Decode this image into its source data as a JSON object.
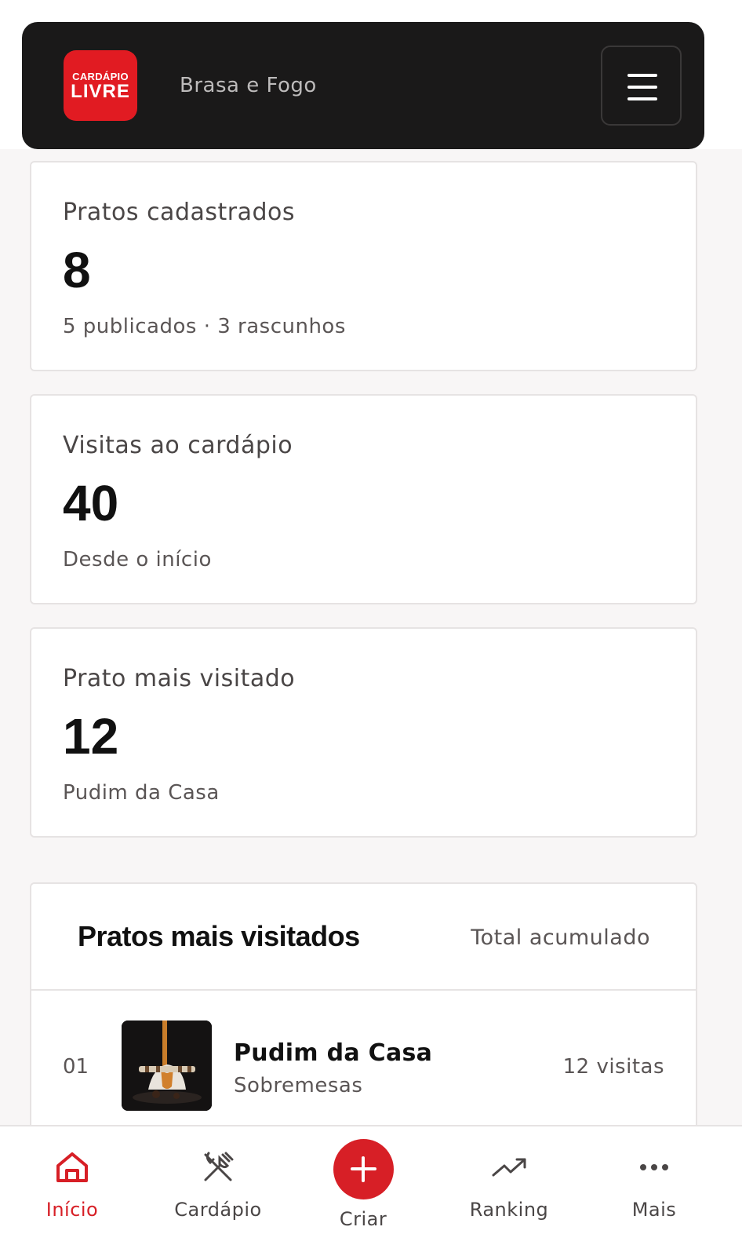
{
  "header": {
    "logo_line1": "CARDÁPIO",
    "logo_line2": "LIVRE",
    "restaurant_name": "Brasa e Fogo",
    "menu_icon": "hamburger-menu-icon"
  },
  "stats": [
    {
      "label": "Pratos cadastrados",
      "value": "8",
      "sub": "5 publicados · 3 rascunhos"
    },
    {
      "label": "Visitas ao cardápio",
      "value": "40",
      "sub": "Desde o início"
    },
    {
      "label": "Prato mais visitado",
      "value": "12",
      "sub": "Pudim da Casa"
    }
  ],
  "ranking": {
    "title": "Pratos mais visitados",
    "subtitle": "Total acumulado",
    "items": [
      {
        "rank": "01",
        "name": "Pudim da Casa",
        "category": "Sobremesas",
        "visits": "12 visitas",
        "image": "pudim-photo"
      }
    ]
  },
  "bottom_nav": {
    "items": [
      {
        "label": "Início",
        "icon": "home-icon",
        "active": true
      },
      {
        "label": "Cardápio",
        "icon": "utensils-crossed-icon",
        "active": false
      },
      {
        "label": "Criar",
        "icon": "plus-icon",
        "active": false
      },
      {
        "label": "Ranking",
        "icon": "trending-up-icon",
        "active": false
      },
      {
        "label": "Mais",
        "icon": "more-horizontal-icon",
        "active": false
      }
    ]
  },
  "colors": {
    "brand_red": "#d71f26",
    "header_bg": "#1a1919",
    "page_bg": "#f8f6f6"
  }
}
